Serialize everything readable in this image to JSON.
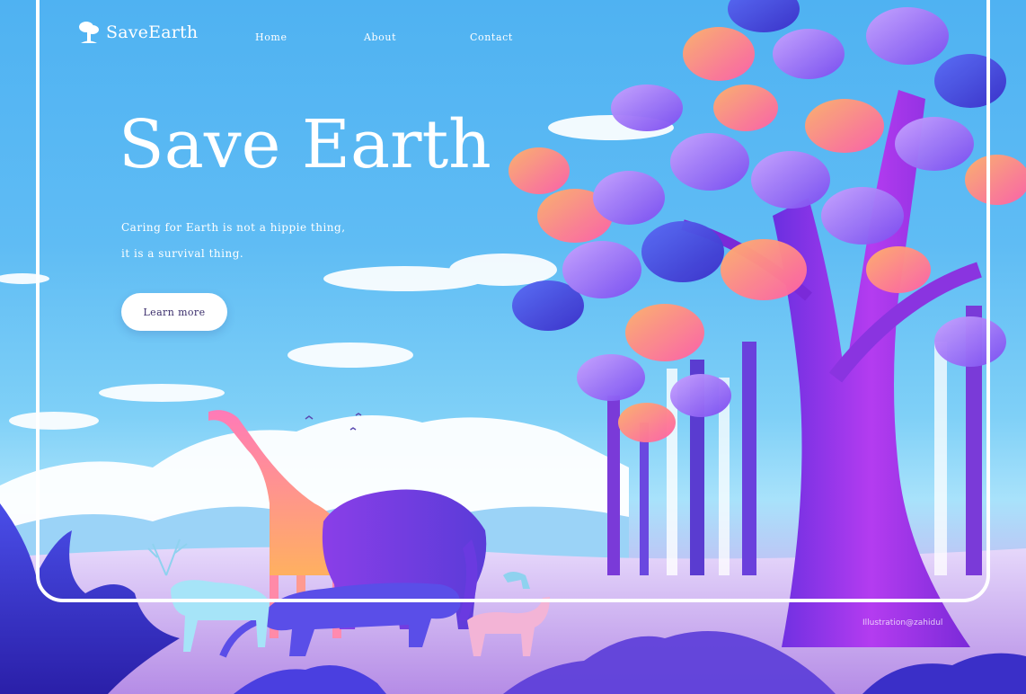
{
  "brand": {
    "name": "SaveEarth",
    "logo_icon": "tree-icon"
  },
  "nav": {
    "items": [
      {
        "label": "Home"
      },
      {
        "label": "About"
      },
      {
        "label": "Contact"
      }
    ]
  },
  "hero": {
    "title": "Save Earth",
    "tagline_line1": "Caring for Earth is not a hippie thing,",
    "tagline_line2": "it is a survival thing.",
    "cta_label": "Learn more"
  },
  "illustration": {
    "credit": "Illustration@zahidul",
    "colors": {
      "sky_top": "#4fb2f2",
      "sky_bottom": "#a8e2fb",
      "ground": "#c9b6f2",
      "tree_trunk": "#9a2ee0",
      "leaf_orange": "#ff9a5c",
      "leaf_purple": "#8a5cf0",
      "leaf_blue": "#4a4ee8",
      "frame": "#ffffff"
    }
  }
}
